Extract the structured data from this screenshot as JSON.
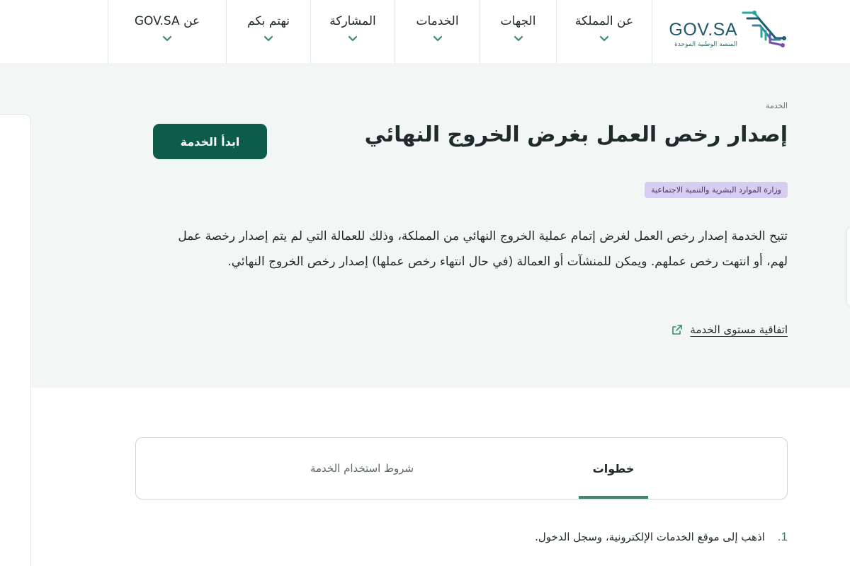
{
  "header": {
    "logo": {
      "title": "GOV.SA",
      "subtitle": "المنصة الوطنية الموحدة"
    },
    "nav": [
      {
        "label": "عن المملكة"
      },
      {
        "label": "الجهات"
      },
      {
        "label": "الخدمات"
      },
      {
        "label": "المشاركة"
      },
      {
        "label": "نهتم بكم"
      },
      {
        "label": "عن GOV.SA"
      }
    ]
  },
  "service": {
    "breadcrumb": "الخدمة",
    "title": "إصدار رخص العمل بغرض الخروج النهائي",
    "start_button": "ابدأ الخدمة",
    "ministry": "وزارة الموارد البشرية والتنمية الاجتماعية",
    "description": "تتيح الخدمة إصدار رخص العمل لغرض إتمام عملية الخروج النهائي من المملكة، وذلك للعمالة التي لم يتم إصدار رخصة عمل لهم، أو انتهت رخص عملهم. ويمكن للمنشآت أو العمالة (في حال انتهاء رخص عملها) إصدار رخص الخروج النهائي.",
    "sla_link": "اتفاقية مستوى الخدمة"
  },
  "tabs": {
    "active": "خطوات",
    "other": "شروط استخدام الخدمة"
  },
  "steps": [
    {
      "number": "1.",
      "text": "اذهب إلى موقع الخدمات الإلكترونية، وسجل الدخول."
    }
  ],
  "colors": {
    "primary": "#0d5c4c",
    "accent_green": "#3d8a6d",
    "hero_background": "#f2f6f5",
    "badge_background": "#d8cdf1"
  }
}
